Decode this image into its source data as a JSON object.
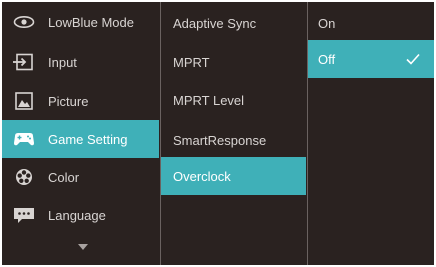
{
  "main_menu": {
    "items": [
      {
        "label": "LowBlue Mode",
        "icon": "eye-icon"
      },
      {
        "label": "Input",
        "icon": "input-icon"
      },
      {
        "label": "Picture",
        "icon": "picture-icon"
      },
      {
        "label": "Game Setting",
        "icon": "gamepad-icon"
      },
      {
        "label": "Color",
        "icon": "color-wheel-icon"
      },
      {
        "label": "Language",
        "icon": "speech-bubble-icon"
      }
    ],
    "selected_index": 3
  },
  "submenu": {
    "items": [
      {
        "label": "Adaptive Sync"
      },
      {
        "label": "MPRT"
      },
      {
        "label": "MPRT Level"
      },
      {
        "label": "SmartResponse"
      },
      {
        "label": "Overclock"
      }
    ],
    "selected_index": 4
  },
  "options": {
    "items": [
      {
        "label": "On"
      },
      {
        "label": "Off"
      }
    ],
    "selected_index": 1
  },
  "colors": {
    "background": "#2a2220",
    "highlight": "#3fb0b8",
    "text": "#d8d4d2"
  }
}
